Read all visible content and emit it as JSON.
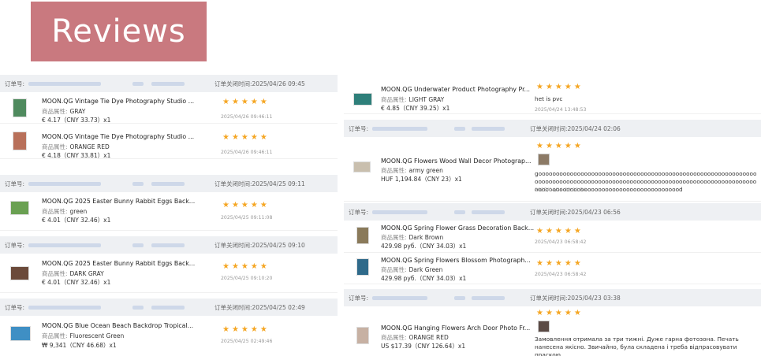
{
  "banner": {
    "title": "Reviews"
  },
  "labels": {
    "order_no": "订单号:",
    "attr_key": "商品属性:"
  },
  "left_orders": [
    {
      "close_time": "订单关闭时间:2025/04/26 09:45",
      "items": [
        {
          "title": "MOON.QG Vintage Tie Dye Photography Studio ...",
          "attr": "GRAY",
          "price": "€ 4.17（CNY 33.73）x1",
          "stars": "★★★★★",
          "date": "2025/04/26 09:46:11",
          "thumb_color": "#4f8a5e"
        },
        {
          "title": "MOON.QG Vintage Tie Dye Photography Studio ...",
          "attr": "ORANGE RED",
          "price": "€ 4.18（CNY 33.81）x1",
          "stars": "★★★★★",
          "date": "2025/04/26 09:46:11",
          "thumb_color": "#b8705a"
        }
      ]
    },
    {
      "close_time": "订单关闭时间:2025/04/25 09:11",
      "items": [
        {
          "title": "MOON.QG 2025 Easter Bunny Rabbit Eggs Back...",
          "attr": "green",
          "price": "€ 4.01（CNY 32.46）x1",
          "stars": "★★★★★",
          "date": "2025/04/25 09:11:08",
          "thumb_color": "#6aa052"
        }
      ]
    },
    {
      "close_time": "订单关闭时间:2025/04/25 09:10",
      "items": [
        {
          "title": "MOON.QG 2025 Easter Bunny Rabbit Eggs Back...",
          "attr": "DARK GRAY",
          "price": "€ 4.01（CNY 32.46）x1",
          "stars": "★★★★★",
          "date": "2025/04/25 09:10:20",
          "thumb_color": "#6b4a3a"
        }
      ]
    },
    {
      "close_time": "订单关闭时间:2025/04/25 02:49",
      "items": [
        {
          "title": "MOON.QG Blue Ocean Beach Backdrop Tropical...",
          "attr": "Fluorescent Green",
          "price": "₩ 9,341（CNY 46.68）x1",
          "stars": "★★★★★",
          "date": "2025/04/25 02:49:46",
          "thumb_color": "#3f8fc4"
        }
      ]
    }
  ],
  "right_orders": [
    {
      "close_time": "",
      "items": [
        {
          "title": "MOON.QG Underwater Product Photography Pr...",
          "attr": "LIGHT GRAY",
          "price": "€ 4.85（CNY 39.25）x1",
          "stars": "★★★★★",
          "review": "het is pvc",
          "date": "2025/04/24 13:48:53",
          "thumb_color": "#2e7f7a"
        }
      ]
    },
    {
      "close_time": "订单关闭时间:2025/04/24 02:06",
      "items": [
        {
          "title": "MOON.QG Flowers Wood Wall Decor Photograp...",
          "attr": "army green",
          "price": "HUF 1,194.84（CNY 23）x1",
          "stars": "★★★★★",
          "review": "gooooooooooooooooooooooooooooooooooooooooooooooooooooooooooooooooooooooooooooooooooooooooooooooooooooooooooooooooooooooooooooooooooooooooooooooooooooooooooooooooooooood",
          "date": "2025/04/24 02:08:54",
          "thumb_color": "#c9bfae"
        }
      ]
    },
    {
      "close_time": "订单关闭时间:2025/04/23 06:56",
      "items": [
        {
          "title": "MOON.QG Spring Flower Grass Decoration Back...",
          "attr": "Dark Brown",
          "price": "429.98 руб.（CNY 34.03）x1",
          "stars": "★★★★★",
          "date": "2025/04/23 06:58:42",
          "thumb_color": "#8a7a5a"
        },
        {
          "title": "MOON.QG Spring Flowers Blossom Photograph...",
          "attr": "Dark Green",
          "price": "429.98 руб.（CNY 34.03）x1",
          "stars": "★★★★★",
          "date": "2025/04/23 06:58:42",
          "thumb_color": "#2f6a8a"
        }
      ]
    },
    {
      "close_time": "订单关闭时间:2025/04/23 03:38",
      "items": [
        {
          "title": "MOON.QG Hanging Flowers Arch Door Photo Fr...",
          "attr": "ORANGE RED",
          "price": "US $17.39（CNY 126.64）x1",
          "stars": "★★★★★",
          "review": "Замовлення отримала за три тижні. Дуже гарна фотозона. Печать нанесена якісно. Звичайно, була складена і треба відпрасовувати праскою.",
          "date": "",
          "thumb_color": "#c7b1a3"
        }
      ]
    }
  ],
  "colors": {
    "banner_bg": "#c9797f",
    "star": "#f5a623",
    "order_head_bg": "#eef0f3"
  }
}
